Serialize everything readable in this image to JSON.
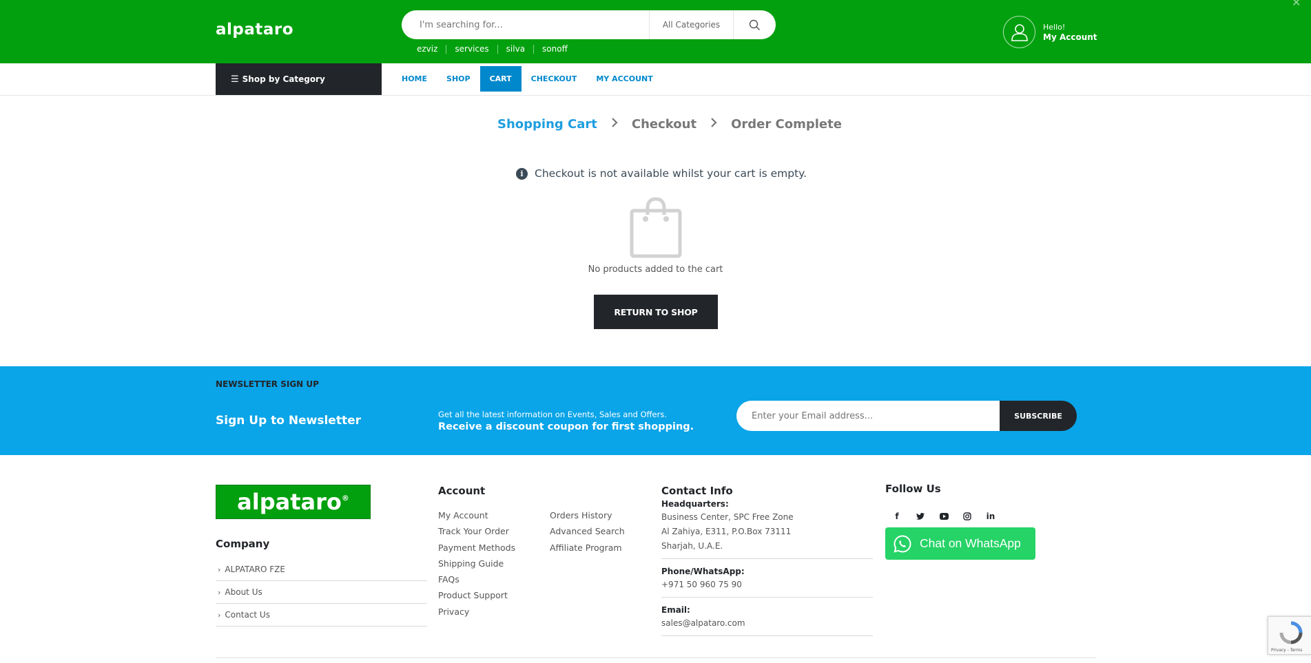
{
  "header": {
    "logo": "alpataro",
    "search_placeholder": "I'm searching for...",
    "search_category": "All Categories",
    "quick_links": [
      "ezviz",
      "services",
      "silva",
      "sonoff"
    ],
    "account_hello": "Hello!",
    "account_label": "My Account"
  },
  "nav": {
    "shop_by_category": "Shop by Category",
    "links": [
      "HOME",
      "SHOP",
      "CART",
      "CHECKOUT",
      "MY ACCOUNT"
    ],
    "active": "CART"
  },
  "steps": {
    "shopping_cart": "Shopping Cart",
    "checkout": "Checkout",
    "order_complete": "Order Complete"
  },
  "cart": {
    "notice": "Checkout is not available whilst your cart is empty.",
    "empty_text": "No products added to the cart",
    "return_button": "RETURN TO SHOP"
  },
  "newsletter": {
    "heading": "NEWSLETTER SIGN UP",
    "title": "Sign Up to Newsletter",
    "description": "Get all the latest information on Events, Sales and Offers.",
    "highlight": "Receive a discount coupon for first shopping.",
    "email_placeholder": "Enter your Email address...",
    "subscribe": "SUBSCRIBE"
  },
  "footer": {
    "logo": "alpataro",
    "logo_mark": "®",
    "company_heading": "Company",
    "company_links": [
      "ALPATARO FZE",
      "About Us",
      "Contact Us"
    ],
    "account_heading": "Account",
    "account_col1": [
      "My Account",
      "Track Your Order",
      "Payment Methods",
      "Shipping Guide",
      "FAQs",
      "Product Support",
      "Privacy"
    ],
    "account_col2": [
      "Orders History",
      "Advanced Search",
      "Affiliate Program"
    ],
    "contact_heading": "Contact Info",
    "hq_label": "Headquarters:",
    "hq_lines": [
      "Business Center, SPC Free Zone",
      "Al Zahiya, E311, P.O.Box 73111",
      "Sharjah, U.A.E."
    ],
    "phone_label": "Phone/WhatsApp:",
    "phone": "+971 50 960 75 90",
    "email_label": "Email:",
    "email": "sales@alpataro.com",
    "follow_heading": "Follow Us",
    "social_icons": [
      "facebook-icon",
      "twitter-icon",
      "youtube-icon",
      "instagram-icon",
      "linkedin-icon"
    ],
    "whatsapp_button": "Chat on WhatsApp"
  },
  "recaptcha": {
    "text": "Privacy - Terms"
  },
  "colors": {
    "brand_green": "#02a00e",
    "accent_blue": "#0188cc",
    "newsletter_blue": "#0aa4e8",
    "dark": "#222529",
    "whatsapp_green": "#25d366"
  }
}
